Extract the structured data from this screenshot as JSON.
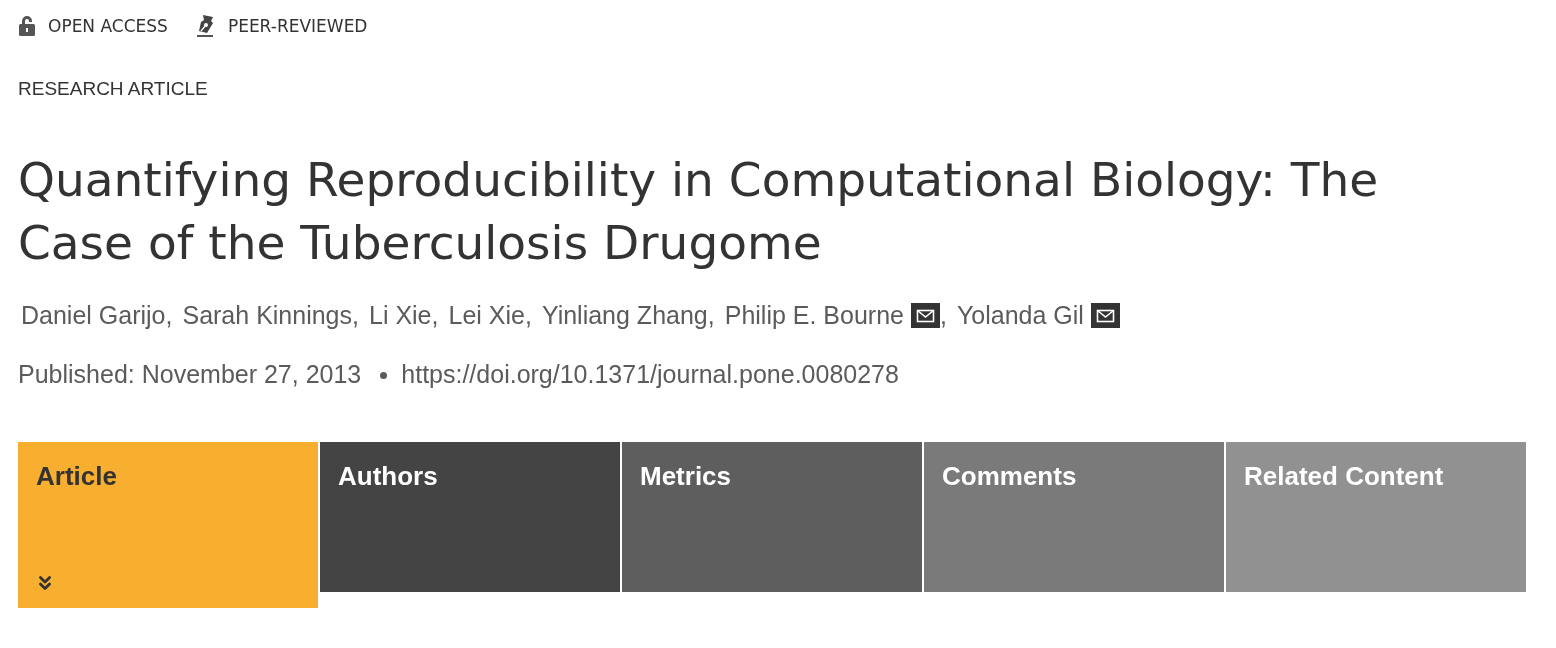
{
  "badges": [
    {
      "kind": "open-access",
      "label": "OPEN ACCESS"
    },
    {
      "kind": "peer-reviewed",
      "label": "PEER-REVIEWED"
    }
  ],
  "article_type": "RESEARCH ARTICLE",
  "title": "Quantifying Reproducibility in Computational Biology: The Case of the Tuberculosis Drugome",
  "authors": [
    {
      "name": "Daniel Garijo",
      "separator": ",",
      "corresponding": false
    },
    {
      "name": "Sarah Kinnings",
      "separator": ",",
      "corresponding": false
    },
    {
      "name": "Li Xie",
      "separator": ",",
      "corresponding": false
    },
    {
      "name": "Lei Xie",
      "separator": ",",
      "corresponding": false
    },
    {
      "name": "Yinliang Zhang",
      "separator": ",",
      "corresponding": false
    },
    {
      "name": "Philip E. Bourne",
      "separator": ",",
      "corresponding": true
    },
    {
      "name": "Yolanda Gil",
      "corresponding": true
    }
  ],
  "publication": {
    "published": "Published: November 27, 2013",
    "doi": "https://doi.org/10.1371/journal.pone.0080278"
  },
  "tabs": [
    {
      "label": "Article",
      "selected": true,
      "color": "#f8ae2e"
    },
    {
      "label": "Authors",
      "selected": false,
      "color": "#444444"
    },
    {
      "label": "Metrics",
      "selected": false,
      "color": "#5e5e5e"
    },
    {
      "label": "Comments",
      "selected": false,
      "color": "#7a7a7a"
    },
    {
      "label": "Related Content",
      "selected": false,
      "color": "#919191"
    }
  ]
}
